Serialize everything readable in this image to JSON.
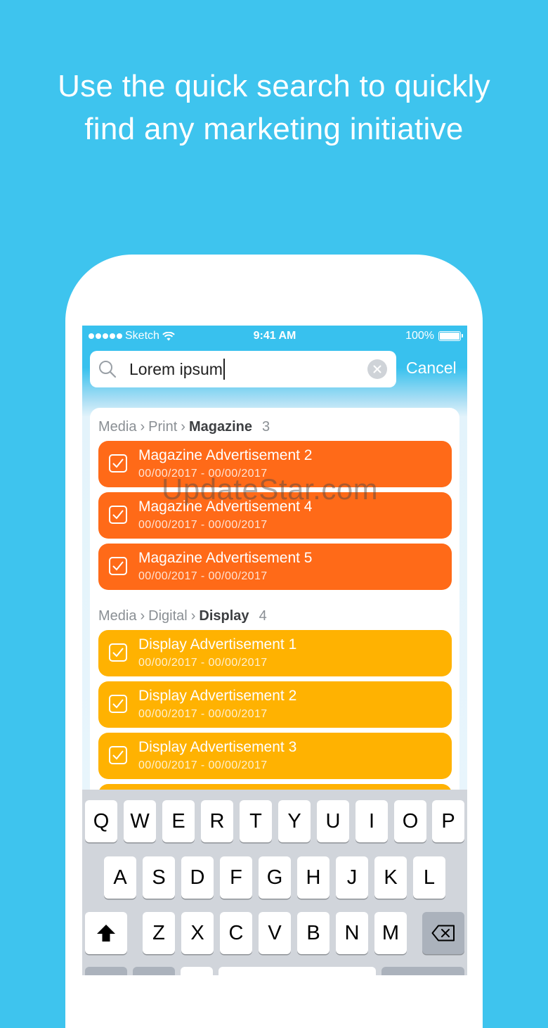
{
  "headline": {
    "line1": "Use the quick search to quickly",
    "line2": "find any marketing initiative"
  },
  "status_bar": {
    "carrier": "Sketch",
    "time": "9:41 AM",
    "battery": "100%",
    "signal_icon": "signal-dots-icon",
    "wifi_icon": "wifi-icon",
    "battery_icon": "battery-icon"
  },
  "search": {
    "value": "Lorem ipsum",
    "cancel_label": "Cancel",
    "search_icon": "magnifier-icon",
    "clear_icon": "clear-circle-icon"
  },
  "results": {
    "groups": [
      {
        "path1": "Media",
        "path2": "Print",
        "category": "Magazine",
        "count": "3",
        "color": "#ff6a18",
        "items": [
          {
            "title": "Magazine Advertisement 2",
            "dates": "00/00/2017 - 00/00/2017"
          },
          {
            "title": "Magazine Advertisement 4",
            "dates": "00/00/2017 - 00/00/2017"
          },
          {
            "title": "Magazine Advertisement 5",
            "dates": "00/00/2017 - 00/00/2017"
          }
        ]
      },
      {
        "path1": "Media",
        "path2": "Digital",
        "category": "Display",
        "count": "4",
        "color": "#ffb201",
        "items": [
          {
            "title": "Display Advertisement 1",
            "dates": "00/00/2017 - 00/00/2017"
          },
          {
            "title": "Display Advertisement 2",
            "dates": "00/00/2017 - 00/00/2017"
          },
          {
            "title": "Display Advertisement 3",
            "dates": "00/00/2017 - 00/00/2017"
          }
        ]
      }
    ],
    "separator": "›"
  },
  "watermark": "UpdateStar.com",
  "keyboard": {
    "row1": [
      "Q",
      "W",
      "E",
      "R",
      "T",
      "Y",
      "U",
      "I",
      "O",
      "P"
    ],
    "row2": [
      "A",
      "S",
      "D",
      "F",
      "G",
      "H",
      "J",
      "K",
      "L"
    ],
    "row3": [
      "Z",
      "X",
      "C",
      "V",
      "B",
      "N",
      "M"
    ],
    "shift_icon": "shift-arrow-icon",
    "delete_icon": "backspace-icon"
  }
}
